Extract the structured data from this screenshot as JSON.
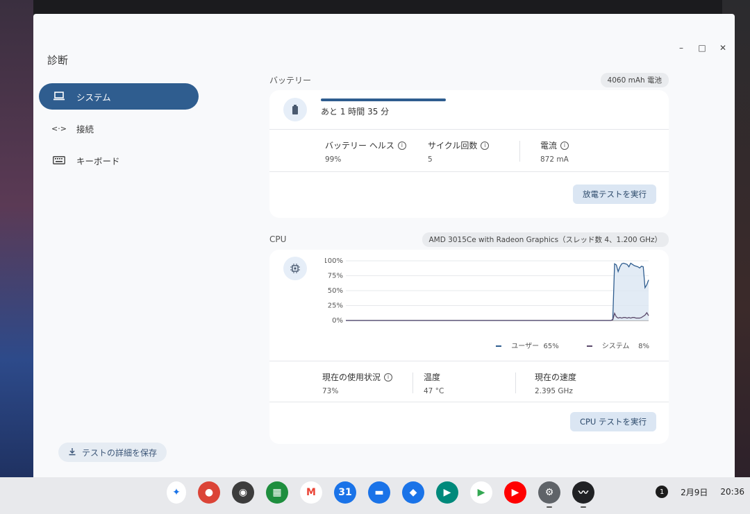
{
  "app": {
    "title": "診断"
  },
  "nav": {
    "items": [
      {
        "label": "システム",
        "icon": "laptop-icon",
        "active": true
      },
      {
        "label": "接続",
        "icon": "connection-icon",
        "active": false
      },
      {
        "label": "キーボード",
        "icon": "keyboard-icon",
        "active": false
      }
    ],
    "save_label": "テストの詳細を保存"
  },
  "battery": {
    "section_title": "バッテリー",
    "capacity_chip": "4060 mAh 電池",
    "charge_level": 0.45,
    "remaining": "あと 1 時間 35 分",
    "health_label": "バッテリー ヘルス",
    "health_value": "99%",
    "cycle_label": "サイクル回数",
    "cycle_value": "5",
    "current_label": "電流",
    "current_value": "872 mA",
    "test_button": "放電テストを実行"
  },
  "cpu": {
    "section_title": "CPU",
    "model_chip": "AMD 3015Ce with Radeon Graphics（スレッド数 4、1.200 GHz）",
    "y_ticks": [
      "100%",
      "75%",
      "50%",
      "25%",
      "0%"
    ],
    "legend_user": "ユーザー",
    "legend_user_value": "65%",
    "legend_system": "システム",
    "legend_system_value": "8%",
    "usage_label": "現在の使用状況",
    "usage_value": "73%",
    "temp_label": "温度",
    "temp_value": "47 °C",
    "speed_label": "現在の速度",
    "speed_value": "2.395 GHz",
    "test_button": "CPU テストを実行"
  },
  "chart_data": {
    "type": "area",
    "y_range": [
      0,
      100
    ],
    "series": [
      {
        "name": "ユーザー",
        "values": [
          0,
          0,
          0,
          0,
          0,
          0,
          0,
          0,
          0,
          0,
          0,
          0,
          0,
          0,
          0,
          0,
          0,
          0,
          0,
          0,
          0,
          0,
          0,
          0,
          0,
          0,
          0,
          0,
          0,
          0,
          0,
          0,
          0,
          0,
          0,
          0,
          0,
          0,
          0,
          0,
          0,
          0,
          0,
          0,
          0,
          0,
          0,
          0,
          0,
          0,
          0,
          0,
          0,
          0,
          0,
          0,
          0,
          0,
          0,
          0,
          0,
          0,
          0,
          0,
          0,
          0,
          0,
          0,
          0,
          0,
          0,
          0,
          0,
          0,
          0,
          0,
          0,
          0,
          0,
          0,
          0,
          0,
          0,
          0,
          0,
          0,
          0,
          0,
          0,
          0,
          0,
          0,
          0,
          0,
          0,
          0,
          0,
          0,
          0,
          0,
          0,
          0,
          0,
          0,
          0,
          0,
          0,
          0,
          0,
          0,
          0,
          0,
          0,
          0,
          0,
          0,
          0,
          0,
          0,
          0,
          0,
          0,
          0,
          0,
          0,
          0,
          0,
          0,
          0,
          0,
          0,
          0,
          0,
          0,
          0,
          0,
          0,
          0,
          0,
          0,
          0,
          0,
          0,
          0,
          0,
          0,
          0,
          0,
          0,
          2,
          95,
          93,
          82,
          90,
          95,
          96,
          95,
          94,
          90,
          96,
          94,
          92,
          91,
          90,
          88,
          91,
          90,
          55,
          60,
          68
        ]
      },
      {
        "name": "システム",
        "values": [
          0,
          0,
          0,
          0,
          0,
          0,
          0,
          0,
          0,
          0,
          0,
          0,
          0,
          0,
          0,
          0,
          0,
          0,
          0,
          0,
          0,
          0,
          0,
          0,
          0,
          0,
          0,
          0,
          0,
          0,
          0,
          0,
          0,
          0,
          0,
          0,
          0,
          0,
          0,
          0,
          0,
          0,
          0,
          0,
          0,
          0,
          0,
          0,
          0,
          0,
          0,
          0,
          0,
          0,
          0,
          0,
          0,
          0,
          0,
          0,
          0,
          0,
          0,
          0,
          0,
          0,
          0,
          0,
          0,
          0,
          0,
          0,
          0,
          0,
          0,
          0,
          0,
          0,
          0,
          0,
          0,
          0,
          0,
          0,
          0,
          0,
          0,
          0,
          0,
          0,
          0,
          0,
          0,
          0,
          0,
          0,
          0,
          0,
          0,
          0,
          0,
          0,
          0,
          0,
          0,
          0,
          0,
          0,
          0,
          0,
          0,
          0,
          0,
          0,
          0,
          0,
          0,
          0,
          0,
          0,
          0,
          0,
          0,
          0,
          0,
          0,
          0,
          0,
          0,
          0,
          0,
          0,
          0,
          0,
          0,
          0,
          0,
          0,
          0,
          0,
          0,
          0,
          0,
          0,
          0,
          0,
          0,
          0,
          0,
          1,
          12,
          6,
          4,
          5,
          4,
          5,
          5,
          4,
          5,
          4,
          5,
          5,
          4,
          4,
          4,
          5,
          7,
          9,
          13,
          8
        ]
      }
    ]
  },
  "taskbar": {
    "apps": [
      {
        "icon": "launcher-icon",
        "color": "#ffffff"
      },
      {
        "icon": "chrome-icon",
        "color": "#db4437"
      },
      {
        "icon": "cast-icon",
        "color": "#3c3c3c"
      },
      {
        "icon": "apps-icon",
        "color": "#1e8e3e"
      },
      {
        "icon": "gmail-icon",
        "color": "#ffffff"
      },
      {
        "icon": "calendar-icon",
        "color": "#1a73e8"
      },
      {
        "icon": "files-icon",
        "color": "#1a73e8"
      },
      {
        "icon": "chat-icon",
        "color": "#1a73e8"
      },
      {
        "icon": "meet-icon",
        "color": "#00897b"
      },
      {
        "icon": "play-store-icon",
        "color": "#ffffff"
      },
      {
        "icon": "youtube-icon",
        "color": "#ff0000"
      },
      {
        "icon": "settings-icon",
        "color": "#5f6368"
      },
      {
        "icon": "diagnostics-icon",
        "color": "#202124"
      }
    ],
    "notification_count": "1",
    "date": "2月9日",
    "time": "20:36"
  }
}
